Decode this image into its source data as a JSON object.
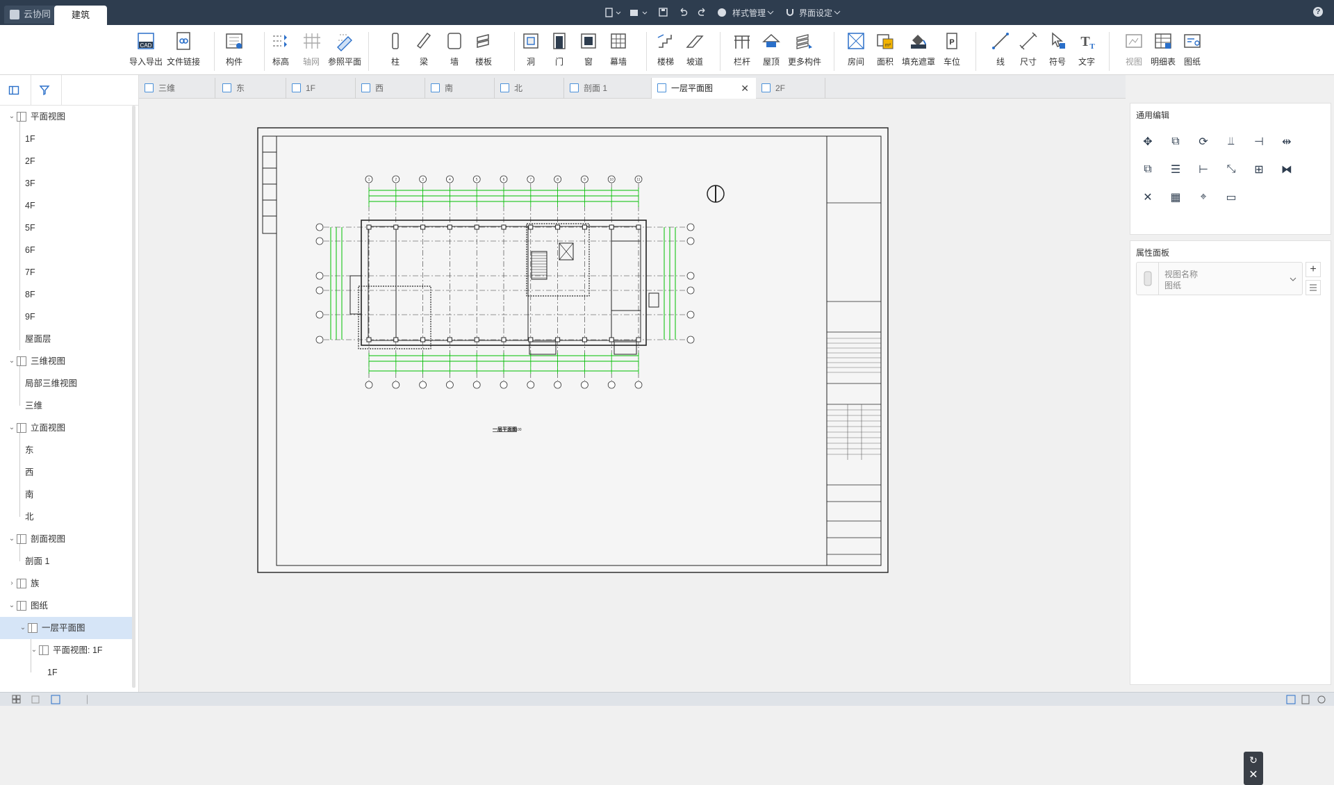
{
  "topbar": {
    "tab_collab": "云协同",
    "tab_arch": "建筑",
    "style_manage": "样式管理",
    "ui_settings": "界面设定",
    "help": "?"
  },
  "ribbon": {
    "groups": [
      {
        "label": "导入导出",
        "icon": "cad-import-icon"
      },
      {
        "label": "文件链接",
        "icon": "file-link-icon"
      },
      {
        "label": "构件",
        "icon": "component-icon"
      },
      {
        "label": "标高",
        "icon": "level-icon"
      },
      {
        "label": "轴网",
        "icon": "grid-icon"
      },
      {
        "label": "参照平面",
        "icon": "reference-plane-icon"
      },
      {
        "label": "柱",
        "icon": "column-icon"
      },
      {
        "label": "梁",
        "icon": "beam-icon"
      },
      {
        "label": "墙",
        "icon": "wall-icon"
      },
      {
        "label": "楼板",
        "icon": "slab-icon"
      },
      {
        "label": "洞",
        "icon": "opening-icon"
      },
      {
        "label": "门",
        "icon": "door-icon"
      },
      {
        "label": "窗",
        "icon": "window-icon"
      },
      {
        "label": "幕墙",
        "icon": "curtain-wall-icon"
      },
      {
        "label": "楼梯",
        "icon": "stair-icon"
      },
      {
        "label": "坡道",
        "icon": "ramp-icon"
      },
      {
        "label": "栏杆",
        "icon": "railing-icon"
      },
      {
        "label": "屋顶",
        "icon": "roof-icon"
      },
      {
        "label": "更多构件",
        "icon": "more-components-icon"
      },
      {
        "label": "房间",
        "icon": "room-icon"
      },
      {
        "label": "面积",
        "icon": "area-icon"
      },
      {
        "label": "填充遮罩",
        "icon": "fill-mask-icon"
      },
      {
        "label": "车位",
        "icon": "parking-icon"
      },
      {
        "label": "线",
        "icon": "line-icon"
      },
      {
        "label": "尺寸",
        "icon": "dimension-icon"
      },
      {
        "label": "符号",
        "icon": "symbol-icon"
      },
      {
        "label": "文字",
        "icon": "text-icon"
      },
      {
        "label": "视图",
        "icon": "view-icon"
      },
      {
        "label": "明细表",
        "icon": "schedule-icon"
      },
      {
        "label": "图纸",
        "icon": "sheet-icon"
      }
    ]
  },
  "tree": {
    "plan_views": "平面视图",
    "floors": [
      "1F",
      "2F",
      "3F",
      "4F",
      "5F",
      "6F",
      "7F",
      "8F",
      "9F",
      "屋面层"
    ],
    "views_3d": "三维视图",
    "views_3d_items": [
      "局部三维视图",
      "三维"
    ],
    "elevations": "立面视图",
    "elevation_items": [
      "东",
      "西",
      "南",
      "北"
    ],
    "sections": "剖面视图",
    "section_items": [
      "剖面 1"
    ],
    "families": "族",
    "sheets": "图纸",
    "sheet_selected": "一层平面图",
    "sheet_child": "平面视图: 1F",
    "sheet_grandchild": "1F"
  },
  "doc_tabs": [
    "三维",
    "东",
    "1F",
    "西",
    "南",
    "北",
    "剖面 1",
    "一层平面图",
    "2F"
  ],
  "active_tab": "一层平面图",
  "drawing": {
    "plan_title": "一层平面图",
    "scale": "1:100",
    "axis_top": [
      "1",
      "2",
      "3",
      "4",
      "5",
      "6",
      "7",
      "8",
      "9",
      "10",
      "11"
    ]
  },
  "right_panel": {
    "general_edit": "通用编辑",
    "properties": "属性面板",
    "view_name_label": "视图名称",
    "view_name_value": "图纸"
  },
  "colors": {
    "topbar": "#2e3d4f",
    "accent": "#2a6fc9",
    "selection": "#d6e5f7",
    "drawing_green": "#00c000"
  }
}
